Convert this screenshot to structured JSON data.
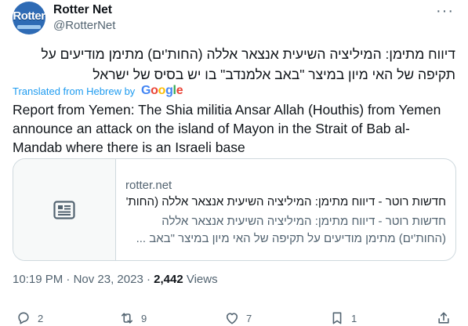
{
  "author": {
    "name": "Rotter Net",
    "handle": "@RotterNet",
    "avatar_text": "Rotter"
  },
  "tweet": {
    "hebrew_text": "דיווח מתימן: המיליציה השיעית אנצאר אללה (החות'ים) מתימן מודיעים על תקיפה של האי מיון במיצר \"באב אלמנדב\" בו יש בסיס של ישראל",
    "translated_label": "Translated from Hebrew by",
    "translator": "Google",
    "translation": "Report from Yemen: The Shia militia Ansar Allah (Houthis) from Yemen announce an attack on the island of Mayon in the Strait of Bab al-Mandab where there is an Israeli base"
  },
  "link_card": {
    "domain": "rotter.net",
    "title": "חדשות רוטר - דיווח מתימן: המיליציה השיעית אנצאר אללה (החות'",
    "description_line1": "חדשות רוטר - דיווח מתימן: המיליציה השיעית אנצאר אללה",
    "description_line2": "(החות'ים) מתימן מודיעים על תקיפה של האי מיון במיצר \"באב ..."
  },
  "meta": {
    "time": "10:19 PM",
    "separator": "·",
    "date": "Nov 23, 2023",
    "views_count": "2,442",
    "views_label": "Views"
  },
  "actions": {
    "replies": "2",
    "retweets": "9",
    "likes": "7",
    "bookmarks": "1"
  },
  "colors": {
    "link_blue": "#1d9bf0",
    "secondary_text": "#536471",
    "border": "#cfd9de"
  }
}
